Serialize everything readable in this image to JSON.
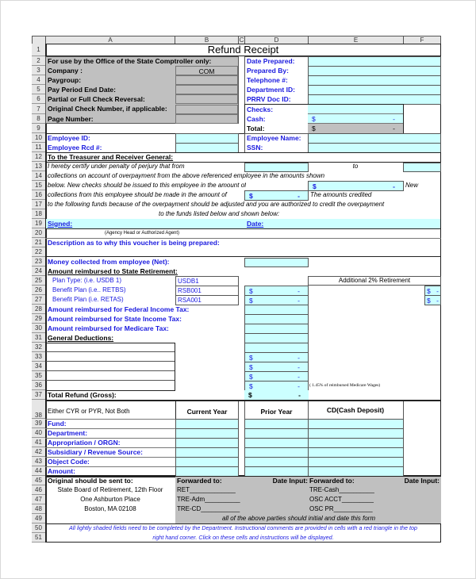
{
  "columns": [
    "A",
    "B",
    "C",
    "D",
    "E",
    "F"
  ],
  "rows": [
    "1",
    "2",
    "3",
    "4",
    "5",
    "6",
    "7",
    "8",
    "9",
    "10",
    "11",
    "12",
    "13",
    "14",
    "15",
    "16",
    "17",
    "18",
    "19",
    "20",
    "21",
    "22",
    "23",
    "24",
    "25",
    "26",
    "27",
    "28",
    "29",
    "30",
    "31",
    "32",
    "33",
    "34",
    "35",
    "36",
    "37",
    "38",
    "39",
    "40",
    "41",
    "42",
    "43",
    "44",
    "45",
    "46",
    "47",
    "48",
    "49",
    "50",
    "51"
  ],
  "title": "Refund Receipt",
  "comptroller": {
    "heading": "For use by the Office of the State Comptroller only:",
    "company_label": "Company :",
    "company_value": "COM",
    "paygroup_label": "Paygroup:",
    "pay_period_label": "Pay Period End Date:",
    "reversal_label": "Partial or Full Check Reversal:",
    "check_number_label": "Original Check Number, if applicable:",
    "page_number_label": "Page Number:"
  },
  "prepared": {
    "date_prepared_label": "Date Prepared:",
    "prepared_by_label": "Prepared By:",
    "telephone_label": "Telephone #:",
    "department_id_label": "Department ID:",
    "prrv_doc_id_label": "PRRV Doc ID:",
    "checks_label": "Checks:",
    "cash_label": "Cash:",
    "cash_currency": "$",
    "cash_value": "-",
    "total_label": "Total:",
    "total_currency": "$",
    "total_value": "-"
  },
  "employee": {
    "id_label": "Employee ID:",
    "rcd_label": "Employee Rcd #:",
    "name_label": "Employee Name:",
    "ssn_label": "SSN:"
  },
  "certification": {
    "heading": "To the Treasurer and Receiver General:",
    "line13": "I hereby certify under penalty of perjury that from",
    "to_label": "to",
    "line14": "collections on account of overpayment from the above referenced employee in the amounts shown",
    "line15": "below.  New checks should be issued to this employee in the amount of",
    "line15_currency": "$",
    "line15_value": "-",
    "new_label": "New",
    "line16": "collections from this employee should be made in the amount of",
    "line16_currency": "$",
    "line16_value": "-",
    "amounts_credited": "The amounts credited",
    "line17": "to the following funds because of the overpayment should be adjusted and you are authorized to credit the overpayment",
    "line18": "to the funds listed below and shown below:",
    "signed_label": "Signed:",
    "date_label": "Date:",
    "signer_note": "(Agency Head or Authorized Agent)"
  },
  "description_label": "Description as to why this voucher is being prepared:",
  "amounts": {
    "money_collected_label": "Money collected from employee (Net):",
    "retirement_heading": "Amount reimbursed to State Retirement:",
    "plan_type_label": "Plan Type:   (i.e. USDB 1)",
    "plan_type_value": "USDB1",
    "benefit_plan1_label": "Benefit Plan (i.e.. RETBS)",
    "benefit_plan1_value": "RSB001",
    "benefit_plan2_label": "Benefit Plan (i.e. RETAS)",
    "benefit_plan2_value": "RSA001",
    "additional_retirement": "Additional 2% Retirement",
    "federal_tax_label": "Amount reimbursed for Federal Income Tax:",
    "state_tax_label": "Amount reimbursed for State Income Tax:",
    "medicare_tax_label": "Amount reimbursed for Medicare Tax:",
    "general_deductions_label": "General Deductions:",
    "medicare_note": "( 1.45% of reimbursed Medicare Wages)",
    "total_refund_label": "Total Refund (Gross):",
    "currency": "$",
    "dash": "-"
  },
  "accounting": {
    "note": "Either CYR or PYR, Not Both",
    "col_current": "Current Year",
    "col_prior": "Prior Year",
    "col_cd": "CD(Cash Deposit)",
    "rows": [
      "Fund:",
      "Department:",
      "Appropriation / ORGN:",
      "Subsidiary / Revenue Source:",
      "Object Code:",
      "Amount:"
    ]
  },
  "routing": {
    "sent_to_label": "Original should be sent to:",
    "address1": "State Board of Retirement, 12th Floor",
    "address2": "One Ashburton Place",
    "address3": "Boston, MA  02108",
    "forwarded_to_label": "Forwarded to:",
    "date_input_label": "Date Input:",
    "left_parties": [
      "RET_____________",
      "TRE-Adm__________",
      "TRE-CD___________"
    ],
    "right_parties": [
      "TRE-Cash__________",
      "OSC ACCT_________",
      "OSC PR___________"
    ],
    "initial_note": "all of the above parties should initial and date this form"
  },
  "footer": {
    "line1": "All lightly shaded fields need to be completed by the Department.  Instructional comments are provided in cells with a red triangle in the top",
    "line2": "right hand corner.  Click on these cells and instructions will be displayed."
  }
}
